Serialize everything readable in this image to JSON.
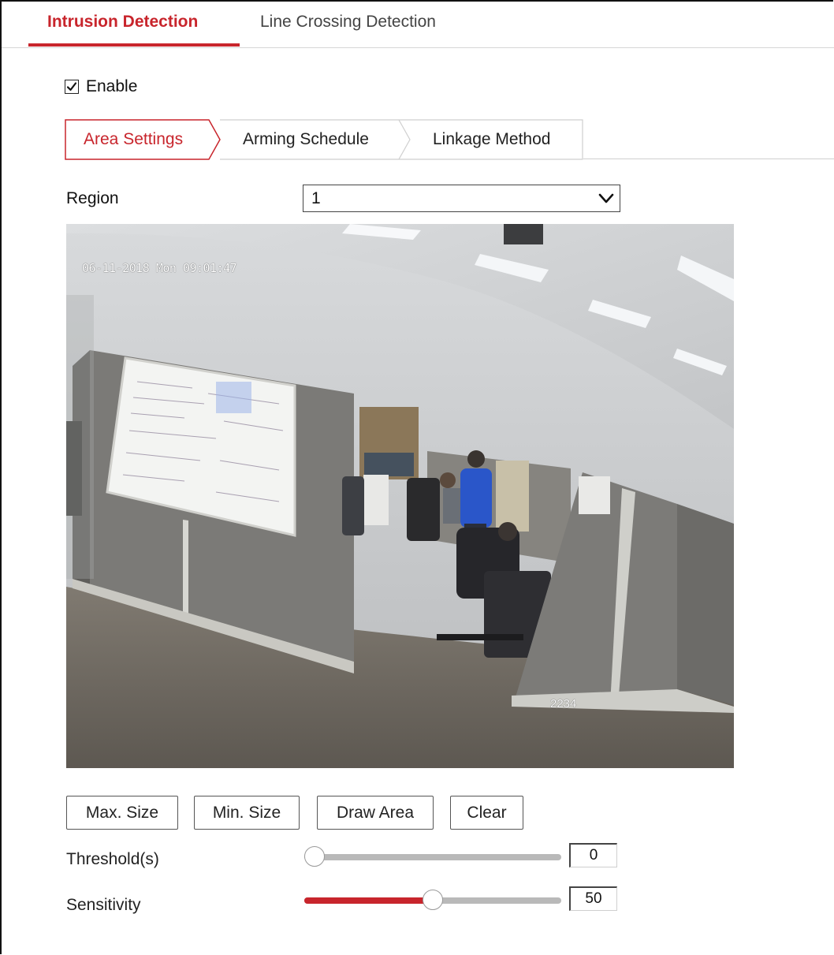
{
  "top_tabs": [
    {
      "label": "Intrusion Detection",
      "active": true
    },
    {
      "label": "Line Crossing Detection",
      "active": false
    }
  ],
  "enable": {
    "label": "Enable",
    "checked": true
  },
  "sub_tabs": [
    {
      "label": "Area Settings",
      "active": true
    },
    {
      "label": "Arming Schedule",
      "active": false
    },
    {
      "label": "Linkage Method",
      "active": false
    }
  ],
  "region": {
    "label": "Region",
    "value": "1"
  },
  "video": {
    "osd_timestamp": "06-11-2018 Mon 09:01:47",
    "osd_camera_label": "2234"
  },
  "buttons": {
    "max_size": "Max. Size",
    "min_size": "Min. Size",
    "draw_area": "Draw Area",
    "clear": "Clear"
  },
  "threshold": {
    "label": "Threshold(s)",
    "value": "0",
    "fraction": 0.0
  },
  "sensitivity": {
    "label": "Sensitivity",
    "value": "50",
    "fraction": 0.5
  },
  "colors": {
    "accent": "#c8252c",
    "track": "#b9b9b9"
  },
  "icons": {
    "checkbox": "checkmark-icon",
    "region_dropdown": "chevron-down-icon"
  }
}
